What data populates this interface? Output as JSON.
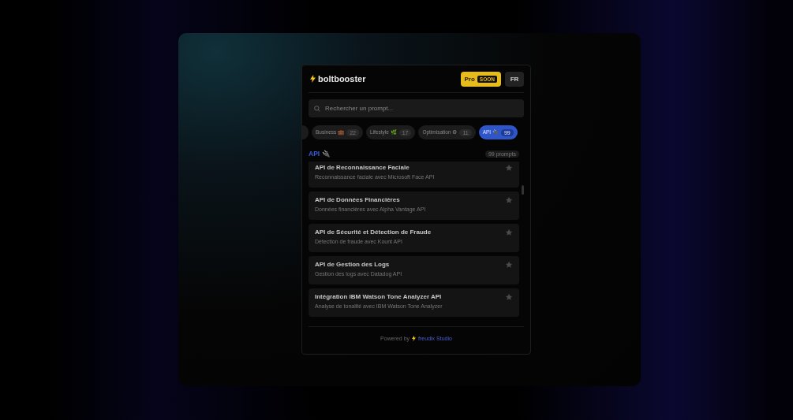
{
  "header": {
    "brand": "boltbooster",
    "pro_button": {
      "label": "Pro",
      "badge": "SOON"
    },
    "language_button": "FR"
  },
  "search": {
    "placeholder": "Rechercher un prompt..."
  },
  "categories": [
    {
      "label": "Business 💼",
      "count": "22",
      "selected": false
    },
    {
      "label": "Lifestyle 🌿",
      "count": "17",
      "selected": false
    },
    {
      "label": "Optimisation ⚙",
      "count": "11",
      "selected": false
    },
    {
      "label": "API 🔌",
      "count": "99",
      "selected": true
    }
  ],
  "section": {
    "title": "API 🔌",
    "count": "99 prompts"
  },
  "prompts": [
    {
      "title": "API de Reconnaissance Faciale",
      "description": "Reconnaissance faciale avec Microsoft Face API",
      "favorite": false
    },
    {
      "title": "API de Données Financières",
      "description": "Données financières avec Alpha Vantage API",
      "favorite": false
    },
    {
      "title": "API de Sécurité et Détection de Fraude",
      "description": "Détection de fraude avec Kount API",
      "favorite": false
    },
    {
      "title": "API de Gestion des Logs",
      "description": "Gestion des logs avec Datadog API",
      "favorite": false
    },
    {
      "title": "Intégration IBM Watson Tone Analyzer API",
      "description": "Analyse de tonalité avec IBM Watson Tone Analyzer",
      "favorite": false
    }
  ],
  "footer": {
    "prefix": "Powered by",
    "brand": "freudix Studio"
  }
}
